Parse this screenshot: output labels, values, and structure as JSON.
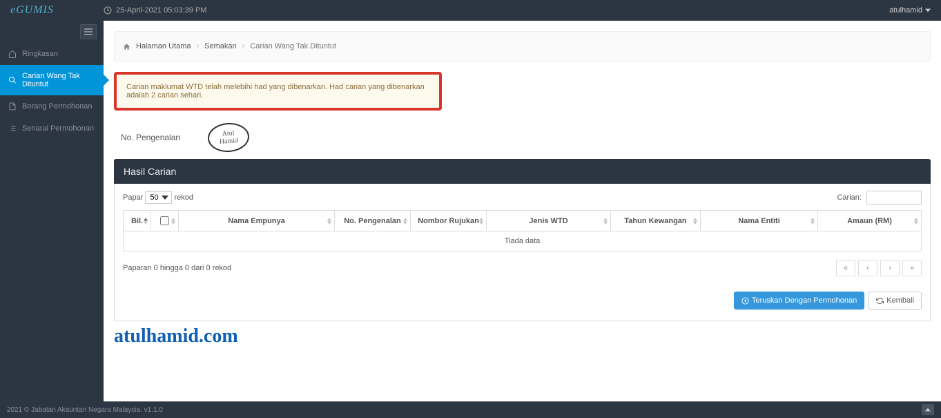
{
  "app": {
    "logo": "eGUMIS",
    "datetime": "25-April-2021 05:03:39 PM",
    "user": "atulhamid"
  },
  "sidebar": {
    "items": [
      {
        "label": "Ringkasan"
      },
      {
        "label": "Carian Wang Tak Dituntut"
      },
      {
        "label": "Borang Permohonan"
      },
      {
        "label": "Senarai Permohonan"
      }
    ]
  },
  "breadcrumb": {
    "home": "Halaman Utama",
    "mid": "Semakan",
    "current": "Carian Wang Tak Dituntut"
  },
  "alert": "Carian maklumat WTD telah melebihi had yang dibenarkan. Had carian yang dibenarkan adalah 2 carian sehari.",
  "form": {
    "label_pengenalan": "No. Pengenalan",
    "stamp_line1": "Atul",
    "stamp_line2": "Hamid"
  },
  "panel": {
    "title": "Hasil Carian"
  },
  "datatable": {
    "show_prefix": "Papar",
    "show_suffix": "rekod",
    "select_value": "50",
    "search_label": "Carian:",
    "columns": [
      "Bil.",
      "",
      "Nama Empunya",
      "No. Pengenalan",
      "Nombor Rujukan",
      "Jenis WTD",
      "Tahun Kewangan",
      "Nama Entiti",
      "Amaun (RM)"
    ],
    "empty": "Tiada data",
    "info": "Paparan 0 hingga 0 dari 0 rekod",
    "pager": [
      "«",
      "‹",
      "›",
      "»"
    ]
  },
  "actions": {
    "continue": "Teruskan Dengan Permohonan",
    "back": "Kembali"
  },
  "watermark": "atulhamid.com",
  "footer": "2021 © Jabatan Akauntan Negara Malaysia. v1.1.0"
}
